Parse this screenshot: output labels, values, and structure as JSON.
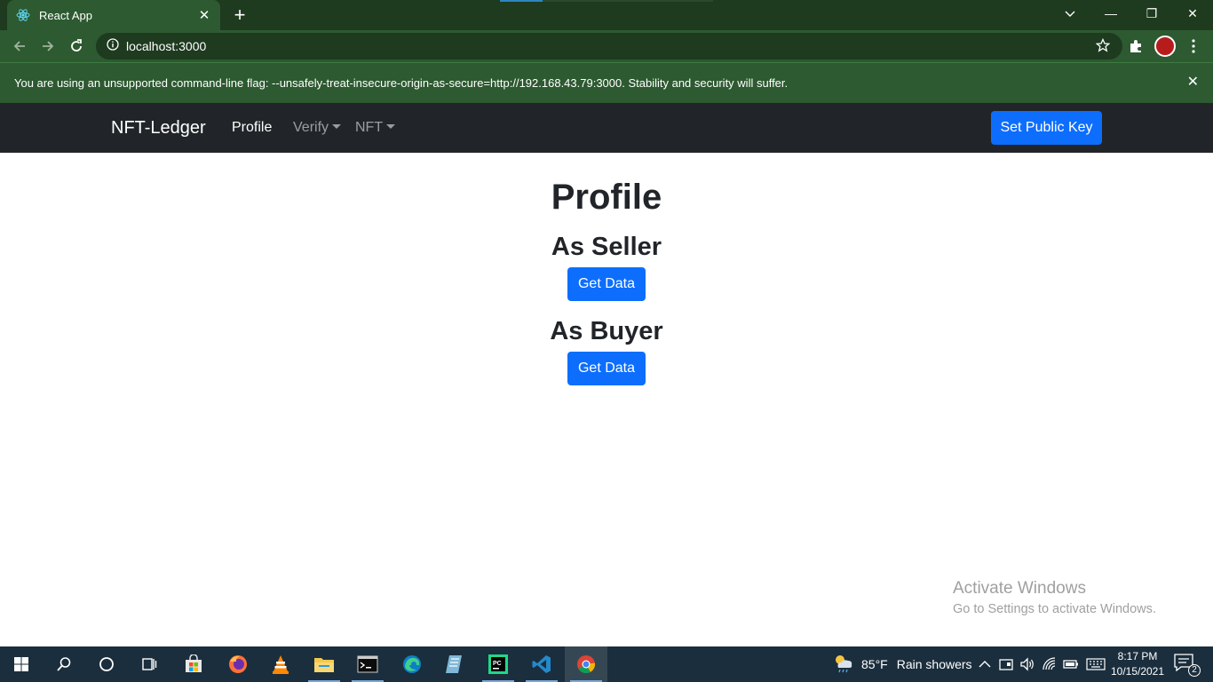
{
  "browser": {
    "tab": {
      "title": "React App",
      "favicon": "react-icon",
      "close_glyph": "✕"
    },
    "new_tab_glyph": "+",
    "window_controls": {
      "minimize": "—",
      "maximize": "❐",
      "close": "✕"
    },
    "address": "localhost:3000",
    "infobar": {
      "message": "You are using an unsupported command-line flag: --unsafely-treat-insecure-origin-as-secure=http://192.168.43.79:3000. Stability and security will suffer.",
      "close_glyph": "✕"
    },
    "colors": {
      "frame": "#1e3a1f",
      "toolbar": "#2d5a30"
    }
  },
  "navbar": {
    "brand": "NFT-Ledger",
    "links": [
      {
        "label": "Profile",
        "active": true
      },
      {
        "label": "Verify",
        "dropdown": true
      },
      {
        "label": "NFT",
        "dropdown": true
      }
    ],
    "action_button": "Set Public Key",
    "colors": {
      "background": "#212529",
      "primary": "#0d6efd"
    }
  },
  "main": {
    "title": "Profile",
    "sections": [
      {
        "heading": "As Seller",
        "button": "Get Data"
      },
      {
        "heading": "As Buyer",
        "button": "Get Data"
      }
    ]
  },
  "watermark": {
    "line1": "Activate Windows",
    "line2": "Go to Settings to activate Windows."
  },
  "taskbar": {
    "apps": [
      "windows-start-icon",
      "search-icon",
      "cortana-icon",
      "task-view-icon",
      "store-icon",
      "firefox-icon",
      "vlc-icon",
      "file-explorer-icon",
      "terminal-icon",
      "edge-icon",
      "notepad-icon",
      "pycharm-icon",
      "vscode-icon",
      "chrome-icon"
    ],
    "weather": {
      "temp": "85°F",
      "condition": "Rain showers"
    },
    "time": "8:17 PM",
    "date": "10/15/2021",
    "notification_count": "2"
  }
}
